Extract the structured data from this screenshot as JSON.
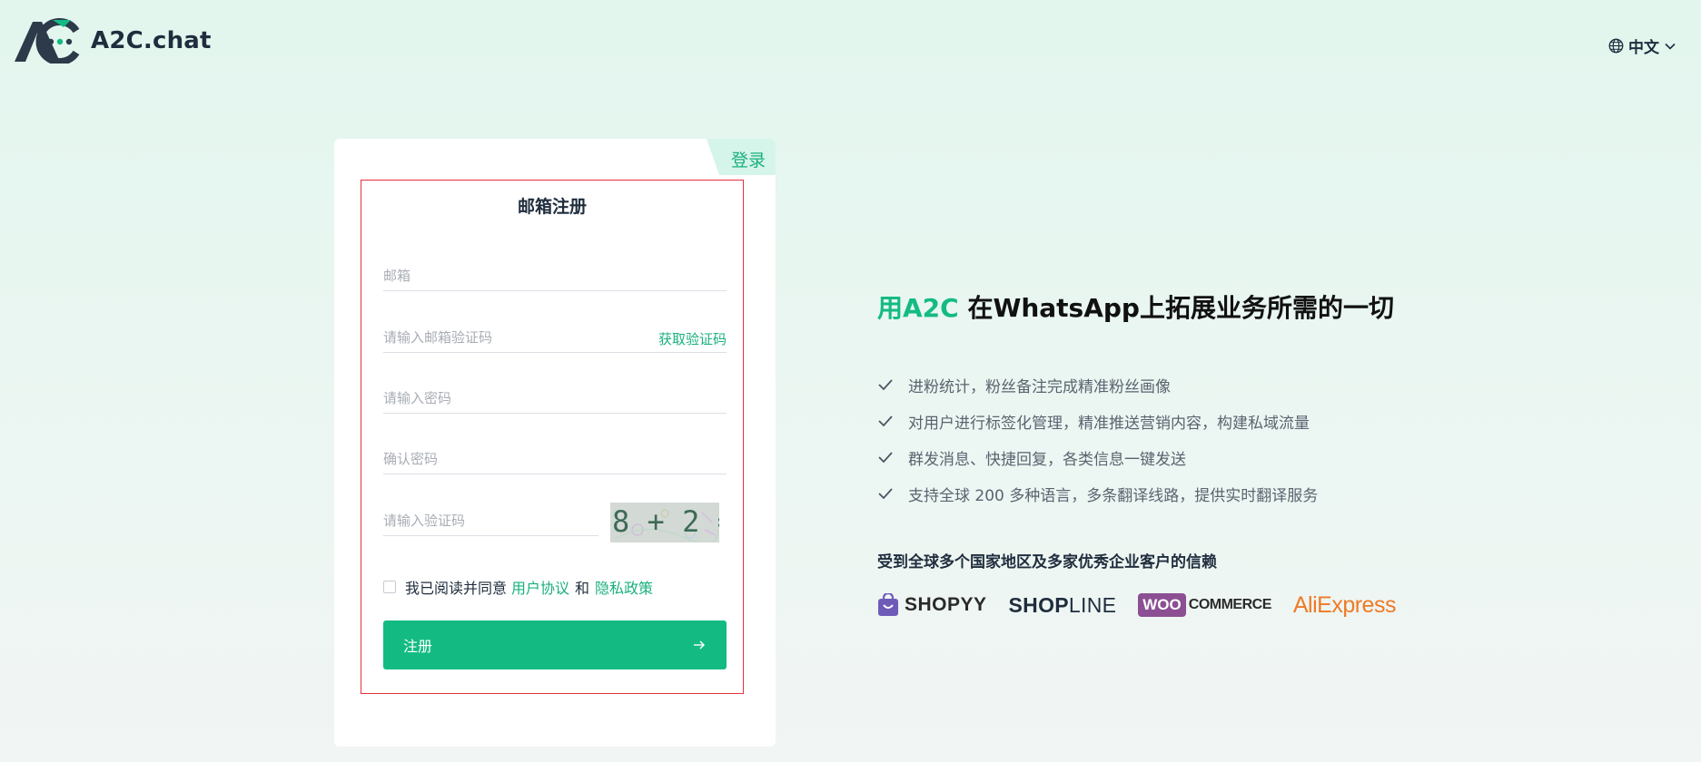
{
  "header": {
    "logo_text": "A2C.chat",
    "language": "中文"
  },
  "card": {
    "login_tab": "登录",
    "title": "邮箱注册",
    "email_placeholder": "邮箱",
    "email_code_placeholder": "请输入邮箱验证码",
    "get_code_label": "获取验证码",
    "password_placeholder": "请输入密码",
    "confirm_password_placeholder": "确认密码",
    "captcha_placeholder": "请输入验证码",
    "captcha_text": "8 + 2 =",
    "agree_text": "我已阅读并同意",
    "user_agreement": "用户协议",
    "and_text": "和",
    "privacy_policy": "隐私政策",
    "submit_label": "注册"
  },
  "promo": {
    "headline_accent": "用A2C",
    "headline_rest": " 在WhatsApp上拓展业务所需的一切",
    "features": [
      "进粉统计，粉丝备注完成精准粉丝画像",
      "对用户进行标签化管理，精准推送营销内容，构建私域流量",
      "群发消息、快捷回复，各类信息一键发送",
      "支持全球 200 多种语言，多条翻译线路，提供实时翻译服务"
    ],
    "trust_title": "受到全球多个国家地区及多家优秀企业客户的信赖",
    "brands": {
      "shopyy": "SHOPYY",
      "shopline_bold": "SHOP",
      "shopline_rest": "LINE",
      "woo_badge": "WOO",
      "woo_rest": "COMMERCE",
      "ali": "AliExpress"
    }
  },
  "colors": {
    "accent": "#13bb82",
    "accent_link": "#19b07e",
    "frame_border": "#e8303c"
  }
}
